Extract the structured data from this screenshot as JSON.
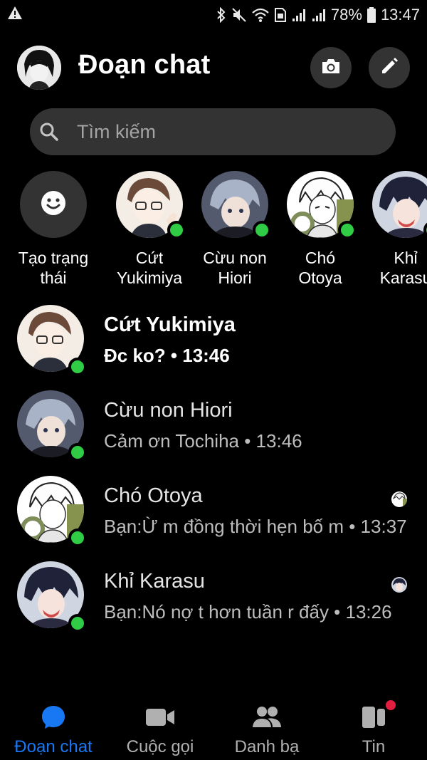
{
  "status_bar": {
    "battery_percent": "78%",
    "time": "13:47",
    "icons": [
      "alert-icon",
      "bluetooth-icon",
      "mute-icon",
      "wifi-icon",
      "sim-icon",
      "signal-icon",
      "signal-icon",
      "battery-icon"
    ]
  },
  "header": {
    "title": "Đoạn chat",
    "icons": [
      "camera-icon",
      "pencil-icon"
    ]
  },
  "search": {
    "placeholder": "Tìm kiếm"
  },
  "stories": [
    {
      "label": "Tạo trạng\nthái",
      "icon": "smiley-icon"
    },
    {
      "label": "Cứt\nYukimiya",
      "online": true
    },
    {
      "label": "Cừu non\nHiori",
      "online": true
    },
    {
      "label": "Chó\nOtoya",
      "online": true
    },
    {
      "label": "Khỉ\nKarasu",
      "online": true
    }
  ],
  "chats": [
    {
      "name": "Cứt Yukimiya",
      "preview": "Đc ko? • 13:46",
      "unread": true,
      "online": true
    },
    {
      "name": "Cừu non Hiori",
      "preview": "Cảm ơn Tochiha  • 13:46",
      "unread": false,
      "online": true
    },
    {
      "name": "Chó Otoya",
      "preview": "Bạn:Ừ m đồng thời hẹn bố m • 13:37",
      "unread": false,
      "online": true
    },
    {
      "name": "Khỉ Karasu",
      "preview": "Bạn:Nó nợ t hơn tuần r đấy • 13:26",
      "unread": false,
      "online": true
    }
  ],
  "bottom_nav": {
    "items": [
      {
        "label": "Đoạn chat",
        "icon": "chat-bubble-icon",
        "active": true
      },
      {
        "label": "Cuộc gọi",
        "icon": "video-camera-icon",
        "active": false
      },
      {
        "label": "Danh bạ",
        "icon": "people-icon",
        "active": false
      },
      {
        "label": "Tin",
        "icon": "stories-icon",
        "active": false
      }
    ]
  },
  "colors": {
    "background": "#000000",
    "button_bg": "#333333",
    "online": "#31cc46",
    "accent": "#1877f2",
    "notification": "#e41e3f"
  }
}
